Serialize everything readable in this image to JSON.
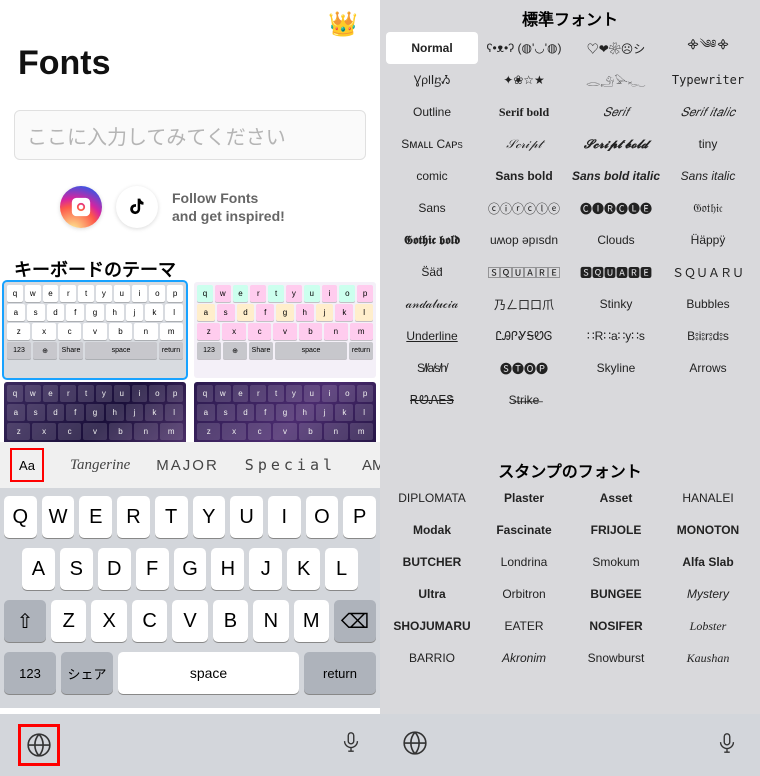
{
  "left": {
    "crown_icon": "👑",
    "title": "Fonts",
    "input_placeholder": "ここに入力してみてください",
    "follow_line1": "Follow Fonts",
    "follow_line2": "and get inspired!",
    "theme_section_title": "キーボードのテーマ",
    "kb_row1": [
      "q",
      "w",
      "e",
      "r",
      "t",
      "y",
      "u",
      "i",
      "o",
      "p"
    ],
    "kb_row2": [
      "a",
      "s",
      "d",
      "f",
      "g",
      "h",
      "j",
      "k",
      "l"
    ],
    "kb_row3": [
      "z",
      "x",
      "c",
      "v",
      "b",
      "n",
      "m"
    ],
    "mini_fn": {
      "num": "123",
      "globe": "⊕",
      "share": "Share",
      "space": "space",
      "return": "return"
    },
    "picker": {
      "selected": "Aa",
      "items": [
        "Tangerine",
        "MAJOR",
        "Special",
        "AMATIC"
      ]
    },
    "keyboard": {
      "row1": [
        "Q",
        "W",
        "E",
        "R",
        "T",
        "Y",
        "U",
        "I",
        "O",
        "P"
      ],
      "row2": [
        "A",
        "S",
        "D",
        "F",
        "G",
        "H",
        "J",
        "K",
        "L"
      ],
      "row3": [
        "Z",
        "X",
        "C",
        "V",
        "B",
        "N",
        "M"
      ],
      "shift": "⇧",
      "backspace": "⌫",
      "num": "123",
      "share": "シェア",
      "space": "space",
      "return": "return"
    },
    "globe": "🌐",
    "mic": "🎤"
  },
  "right": {
    "section1_title": "標準フォント",
    "fonts": [
      "Normal",
      "ʕ•ᴥ•ʔ (◍'◡'◍)",
      "♡❤❀☹シ",
      "᯽༄༅᯽",
      "ƔρƖⵏⴝᏱ",
      "✦❀☆★",
      "𓂋𓄂𓅪𓆑",
      "Typewriter",
      "Outline",
      "Serif bold",
      "𝑆𝑒𝑟𝑖𝑓",
      "𝑆𝑒𝑟𝑖𝑓 𝑖𝑡𝑎𝑙𝑖𝑐",
      "Sᴍᴀʟʟ Cᴀᴘs",
      "𝒮𝒸𝓇𝒾𝓅𝓉",
      "𝓢𝓬𝓻𝓲𝓹𝓽 𝓫𝓸𝓵𝓭",
      "tiny",
      "comic",
      "Sans bold",
      "Sans bold italic",
      "Sans italic",
      "Sans",
      "ⓒⓘⓡⓒⓛⓔ",
      "🅒🅘🅡🅒🅛🅔",
      "𝔊𝔬𝔱𝔥𝔦𝔠",
      "𝕲𝖔𝖙𝖍𝖎𝖈 𝖇𝖔𝖑𝖉",
      "uʍop ǝpısdn",
      "Clouds",
      "Ḧäppÿ",
      "S̈äd̈",
      "🅂🅀🅄🄰🅁🄴",
      "🆂🆀🆄🅰🆁🅴",
      "ＳＱＵＡＲＵ",
      "𝒶𝓃𝒹𝒶𝓁𝓊𝒸𝒾𝒶",
      "乃ㄥ口口爪",
      "Stinky",
      "Bubbles",
      "Underline",
      "ᏝᎯᎵᎽᎦᏬᎶ",
      "∷R∷a∷y∷s",
      "B⦂i⦂r⦂d⦂s",
      "S̸l̸a̸s̸h̸",
      "🅢🅣🅞🅟",
      "Skyline",
      "Arrows",
      "ᎡᏬᏁᎬᏕ",
      "S̶t̶r̶i̶k̶e̶",
      "",
      ""
    ],
    "section2_title": "スタンプのフォント",
    "stamps": [
      "DIPLOMATA",
      "Plaster",
      "Asset",
      "HANALEI",
      "Modak",
      "Fascinate",
      "FRIJOLE",
      "MONOTON",
      "BUTCHER",
      "Londrina",
      "Smokum",
      "Alfa Slab",
      "Ultra",
      "Orbitron",
      "BUNGEE",
      "Mystery",
      "SHOJUMARU",
      "EATER",
      "NOSIFER",
      "Lobster",
      "BARRIO",
      "Akronim",
      "Snowburst",
      "Kaushan"
    ],
    "globe": "🌐",
    "mic": "🎤"
  }
}
